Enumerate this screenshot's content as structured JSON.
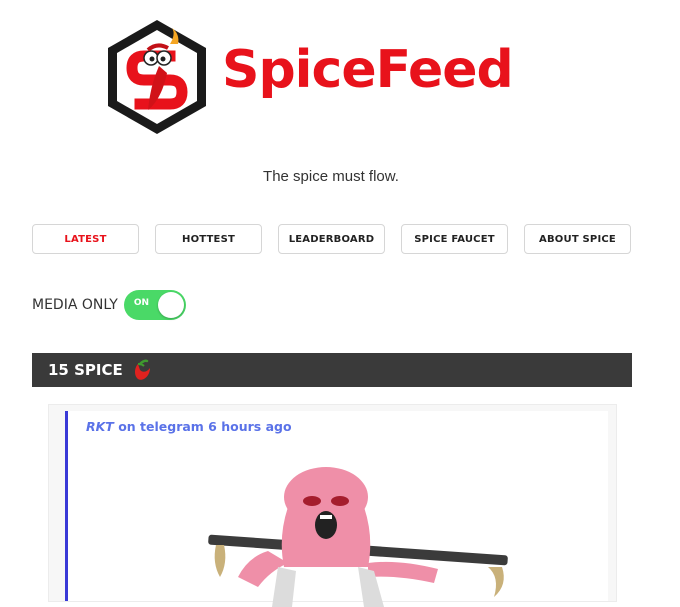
{
  "brand": {
    "name": "SpiceFeed",
    "tagline": "The spice must flow."
  },
  "nav": [
    {
      "label": "LATEST",
      "active": true
    },
    {
      "label": "HOTTEST",
      "active": false
    },
    {
      "label": "LEADERBOARD",
      "active": false
    },
    {
      "label": "SPICE FAUCET",
      "active": false
    },
    {
      "label": "ABOUT SPICE",
      "active": false
    }
  ],
  "filter": {
    "media_only_label": "MEDIA ONLY",
    "toggle_state": "ON"
  },
  "post": {
    "spice_count": "15 SPICE",
    "user": "RKT",
    "meta_rest": " on telegram 6 hours ago"
  },
  "colors": {
    "brand_red": "#e8121b",
    "toggle_green": "#4ad967",
    "header_dark": "#3a3a3a",
    "accent_blue": "#3a3ad7",
    "link_blue": "#5a72e8"
  },
  "icons": [
    "pepper-logo-icon",
    "pepper-icon"
  ]
}
